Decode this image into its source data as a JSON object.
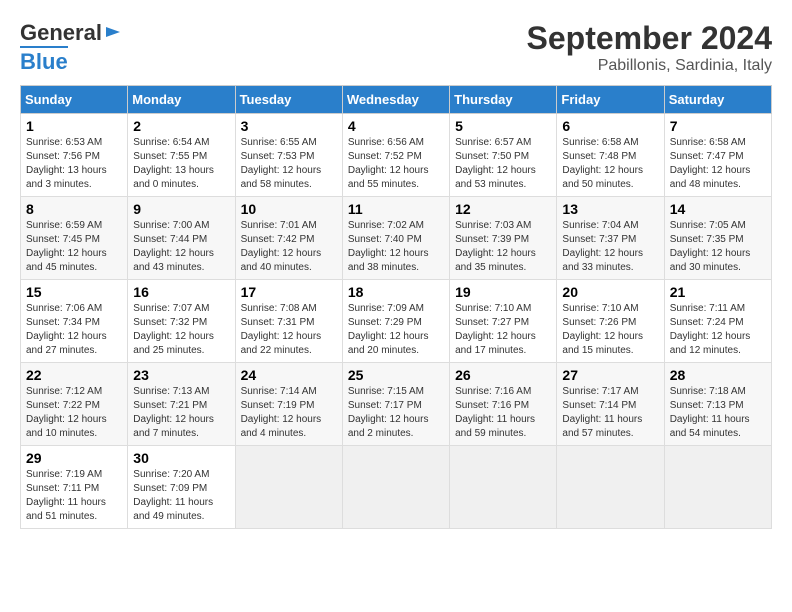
{
  "header": {
    "logo_general": "General",
    "logo_blue": "Blue",
    "month": "September 2024",
    "location": "Pabillonis, Sardinia, Italy"
  },
  "weekdays": [
    "Sunday",
    "Monday",
    "Tuesday",
    "Wednesday",
    "Thursday",
    "Friday",
    "Saturday"
  ],
  "weeks": [
    [
      {
        "day": "1",
        "info": "Sunrise: 6:53 AM\nSunset: 7:56 PM\nDaylight: 13 hours\nand 3 minutes."
      },
      {
        "day": "2",
        "info": "Sunrise: 6:54 AM\nSunset: 7:55 PM\nDaylight: 13 hours\nand 0 minutes."
      },
      {
        "day": "3",
        "info": "Sunrise: 6:55 AM\nSunset: 7:53 PM\nDaylight: 12 hours\nand 58 minutes."
      },
      {
        "day": "4",
        "info": "Sunrise: 6:56 AM\nSunset: 7:52 PM\nDaylight: 12 hours\nand 55 minutes."
      },
      {
        "day": "5",
        "info": "Sunrise: 6:57 AM\nSunset: 7:50 PM\nDaylight: 12 hours\nand 53 minutes."
      },
      {
        "day": "6",
        "info": "Sunrise: 6:58 AM\nSunset: 7:48 PM\nDaylight: 12 hours\nand 50 minutes."
      },
      {
        "day": "7",
        "info": "Sunrise: 6:58 AM\nSunset: 7:47 PM\nDaylight: 12 hours\nand 48 minutes."
      }
    ],
    [
      {
        "day": "8",
        "info": "Sunrise: 6:59 AM\nSunset: 7:45 PM\nDaylight: 12 hours\nand 45 minutes."
      },
      {
        "day": "9",
        "info": "Sunrise: 7:00 AM\nSunset: 7:44 PM\nDaylight: 12 hours\nand 43 minutes."
      },
      {
        "day": "10",
        "info": "Sunrise: 7:01 AM\nSunset: 7:42 PM\nDaylight: 12 hours\nand 40 minutes."
      },
      {
        "day": "11",
        "info": "Sunrise: 7:02 AM\nSunset: 7:40 PM\nDaylight: 12 hours\nand 38 minutes."
      },
      {
        "day": "12",
        "info": "Sunrise: 7:03 AM\nSunset: 7:39 PM\nDaylight: 12 hours\nand 35 minutes."
      },
      {
        "day": "13",
        "info": "Sunrise: 7:04 AM\nSunset: 7:37 PM\nDaylight: 12 hours\nand 33 minutes."
      },
      {
        "day": "14",
        "info": "Sunrise: 7:05 AM\nSunset: 7:35 PM\nDaylight: 12 hours\nand 30 minutes."
      }
    ],
    [
      {
        "day": "15",
        "info": "Sunrise: 7:06 AM\nSunset: 7:34 PM\nDaylight: 12 hours\nand 27 minutes."
      },
      {
        "day": "16",
        "info": "Sunrise: 7:07 AM\nSunset: 7:32 PM\nDaylight: 12 hours\nand 25 minutes."
      },
      {
        "day": "17",
        "info": "Sunrise: 7:08 AM\nSunset: 7:31 PM\nDaylight: 12 hours\nand 22 minutes."
      },
      {
        "day": "18",
        "info": "Sunrise: 7:09 AM\nSunset: 7:29 PM\nDaylight: 12 hours\nand 20 minutes."
      },
      {
        "day": "19",
        "info": "Sunrise: 7:10 AM\nSunset: 7:27 PM\nDaylight: 12 hours\nand 17 minutes."
      },
      {
        "day": "20",
        "info": "Sunrise: 7:10 AM\nSunset: 7:26 PM\nDaylight: 12 hours\nand 15 minutes."
      },
      {
        "day": "21",
        "info": "Sunrise: 7:11 AM\nSunset: 7:24 PM\nDaylight: 12 hours\nand 12 minutes."
      }
    ],
    [
      {
        "day": "22",
        "info": "Sunrise: 7:12 AM\nSunset: 7:22 PM\nDaylight: 12 hours\nand 10 minutes."
      },
      {
        "day": "23",
        "info": "Sunrise: 7:13 AM\nSunset: 7:21 PM\nDaylight: 12 hours\nand 7 minutes."
      },
      {
        "day": "24",
        "info": "Sunrise: 7:14 AM\nSunset: 7:19 PM\nDaylight: 12 hours\nand 4 minutes."
      },
      {
        "day": "25",
        "info": "Sunrise: 7:15 AM\nSunset: 7:17 PM\nDaylight: 12 hours\nand 2 minutes."
      },
      {
        "day": "26",
        "info": "Sunrise: 7:16 AM\nSunset: 7:16 PM\nDaylight: 11 hours\nand 59 minutes."
      },
      {
        "day": "27",
        "info": "Sunrise: 7:17 AM\nSunset: 7:14 PM\nDaylight: 11 hours\nand 57 minutes."
      },
      {
        "day": "28",
        "info": "Sunrise: 7:18 AM\nSunset: 7:13 PM\nDaylight: 11 hours\nand 54 minutes."
      }
    ],
    [
      {
        "day": "29",
        "info": "Sunrise: 7:19 AM\nSunset: 7:11 PM\nDaylight: 11 hours\nand 51 minutes."
      },
      {
        "day": "30",
        "info": "Sunrise: 7:20 AM\nSunset: 7:09 PM\nDaylight: 11 hours\nand 49 minutes."
      },
      {
        "day": "",
        "info": ""
      },
      {
        "day": "",
        "info": ""
      },
      {
        "day": "",
        "info": ""
      },
      {
        "day": "",
        "info": ""
      },
      {
        "day": "",
        "info": ""
      }
    ]
  ]
}
